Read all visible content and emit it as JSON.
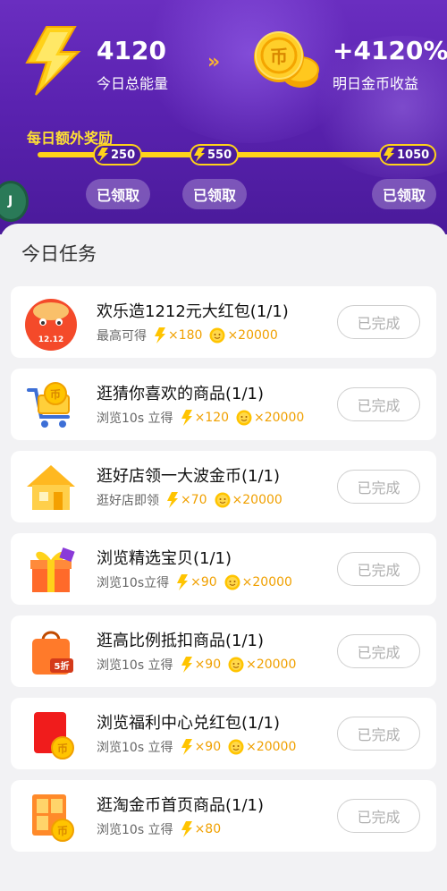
{
  "header": {
    "energy_value": "4120",
    "energy_label": "今日总能量",
    "gain_value": "+4120%",
    "gain_label": "明日金币收益",
    "extra_title": "每日额外奖励",
    "milestones": [
      {
        "value": "250",
        "claim_label": "已领取"
      },
      {
        "value": "550",
        "claim_label": "已领取"
      },
      {
        "value": "1050",
        "claim_label": "已领取"
      }
    ]
  },
  "tasks_title": "今日任务",
  "tasks": [
    {
      "title": "欢乐造1212元大红包(1/1)",
      "sub_label": "最高可得",
      "energy": "×180",
      "coins": "×20000",
      "button": "已完成",
      "icon": "red-envelope-1212-icon",
      "icon_text": "12.12"
    },
    {
      "title": "逛猜你喜欢的商品(1/1)",
      "sub_label": "浏览10s 立得",
      "energy": "×120",
      "coins": "×20000",
      "button": "已完成",
      "icon": "shopping-cart-coin-icon"
    },
    {
      "title": "逛好店领一大波金币(1/1)",
      "sub_label": "逛好店即领",
      "energy": "×70",
      "coins": "×20000",
      "button": "已完成",
      "icon": "shop-house-icon"
    },
    {
      "title": "浏览精选宝贝(1/1)",
      "sub_label": "浏览10s立得",
      "energy": "×90",
      "coins": "×20000",
      "button": "已完成",
      "icon": "gift-box-icon"
    },
    {
      "title": "逛高比例抵扣商品(1/1)",
      "sub_label": "浏览10s 立得",
      "energy": "×90",
      "coins": "×20000",
      "button": "已完成",
      "icon": "discount-bag-icon",
      "icon_text": "5折"
    },
    {
      "title": "浏览福利中心兑红包(1/1)",
      "sub_label": "浏览10s 立得",
      "energy": "×90",
      "coins": "×20000",
      "button": "已完成",
      "icon": "red-packet-coin-icon"
    },
    {
      "title": "逛淘金币首页商品(1/1)",
      "sub_label": "浏览10s 立得",
      "energy": "×80",
      "button": "已完成",
      "icon": "grid-window-coin-icon"
    }
  ],
  "colors": {
    "header_purple": "#5a22b0",
    "accent_yellow": "#ffd21a",
    "energy_orange": "#f0a000"
  }
}
